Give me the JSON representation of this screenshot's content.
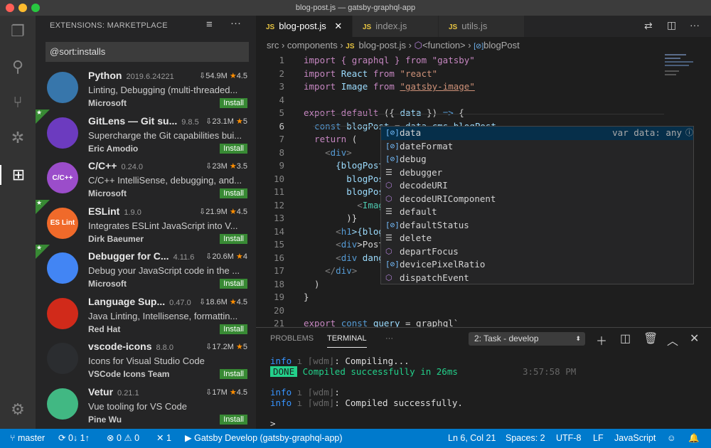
{
  "window": {
    "title": "blog-post.js — gatsby-graphql-app"
  },
  "activity": [
    "files-icon",
    "search-icon",
    "source-control-icon",
    "debug-icon",
    "extensions-icon",
    "gear-icon"
  ],
  "sidebar": {
    "title": "EXTENSIONS: MARKETPLACE",
    "search_value": "@sort:installs",
    "install_label": "Install",
    "extensions": [
      {
        "name": "Python",
        "version": "2019.6.24221",
        "downloads": "54.9M",
        "rating": "4.5",
        "desc": "Linting, Debugging (multi-threaded...",
        "publisher": "Microsoft",
        "featured": false,
        "logo_text": "",
        "logo_color": "#3776ab"
      },
      {
        "name": "GitLens — Git su...",
        "version": "9.8.5",
        "downloads": "23.1M",
        "rating": "5",
        "desc": "Supercharge the Git capabilities bui...",
        "publisher": "Eric Amodio",
        "featured": true,
        "logo_text": "",
        "logo_color": "#6c3bbf"
      },
      {
        "name": "C/C++",
        "version": "0.24.0",
        "downloads": "23M",
        "rating": "3.5",
        "desc": "C/C++ IntelliSense, debugging, and...",
        "publisher": "Microsoft",
        "featured": false,
        "logo_text": "C/C++",
        "logo_color": "#9b4dca"
      },
      {
        "name": "ESLint",
        "version": "1.9.0",
        "downloads": "21.9M",
        "rating": "4.5",
        "desc": "Integrates ESLint JavaScript into V...",
        "publisher": "Dirk Baeumer",
        "featured": true,
        "logo_text": "ES Lint",
        "logo_color": "#f06a2a"
      },
      {
        "name": "Debugger for C...",
        "version": "4.11.6",
        "downloads": "20.6M",
        "rating": "4",
        "desc": "Debug your JavaScript code in the ...",
        "publisher": "Microsoft",
        "featured": true,
        "logo_text": "",
        "logo_color": "#4285f4"
      },
      {
        "name": "Language Sup...",
        "version": "0.47.0",
        "downloads": "18.6M",
        "rating": "4.5",
        "desc": "Java Linting, Intellisense, formattin...",
        "publisher": "Red Hat",
        "featured": false,
        "logo_text": "",
        "logo_color": "#d12a1a"
      },
      {
        "name": "vscode-icons",
        "version": "8.8.0",
        "downloads": "17.2M",
        "rating": "5",
        "desc": "Icons for Visual Studio Code",
        "publisher": "VSCode Icons Team",
        "featured": false,
        "logo_text": "",
        "logo_color": "#2b2d30"
      },
      {
        "name": "Vetur",
        "version": "0.21.1",
        "downloads": "17M",
        "rating": "4.5",
        "desc": "Vue tooling for VS Code",
        "publisher": "Pine Wu",
        "featured": false,
        "logo_text": "",
        "logo_color": "#41b883"
      }
    ]
  },
  "tabs": [
    {
      "label": "blog-post.js",
      "active": true
    },
    {
      "label": "index.js",
      "active": false
    },
    {
      "label": "utils.js",
      "active": false
    }
  ],
  "breadcrumb": [
    "src",
    "components",
    "blog-post.js",
    "<function>",
    "blogPost"
  ],
  "code": [
    [
      [
        "import { graphql } from \"gatsby\"",
        "kw"
      ]
    ],
    [
      [
        "import ",
        "kw"
      ],
      [
        "React ",
        "v"
      ],
      [
        "from ",
        "kw"
      ],
      [
        "\"react\"",
        "s"
      ]
    ],
    [
      [
        "import ",
        "kw"
      ],
      [
        "Image ",
        "v"
      ],
      [
        "from ",
        "kw"
      ],
      [
        "\"gatsby-image\"",
        "u"
      ]
    ],
    [],
    [
      [
        "export default ",
        "kw"
      ],
      [
        "({ ",
        "p"
      ],
      [
        "data",
        "v"
      ],
      [
        " }) ",
        "p"
      ],
      [
        "=>",
        "b"
      ],
      [
        " {",
        "p"
      ]
    ],
    [
      [
        "  const ",
        "b"
      ],
      [
        "blogPost",
        "v"
      ],
      [
        " = ",
        "p"
      ],
      [
        "data",
        "v"
      ],
      [
        ".cms.blogPost",
        "v"
      ]
    ],
    [
      [
        "  return ",
        "kw"
      ],
      [
        "(",
        "p"
      ]
    ],
    [
      [
        "    <",
        "g"
      ],
      [
        "div",
        "b"
      ],
      [
        ">",
        "g"
      ]
    ],
    [
      [
        "      {blogPost",
        "v"
      ]
    ],
    [
      [
        "        blogPos",
        "v"
      ]
    ],
    [
      [
        "        blogPos",
        "v"
      ]
    ],
    [
      [
        "          <",
        "g"
      ],
      [
        "Imag",
        "t"
      ]
    ],
    [
      [
        "        )}",
        "p"
      ]
    ],
    [
      [
        "      <",
        "g"
      ],
      [
        "h1",
        "b"
      ],
      [
        ">{blog",
        "v"
      ]
    ],
    [
      [
        "      <",
        "g"
      ],
      [
        "div",
        "b"
      ],
      [
        ">Post",
        "p"
      ]
    ],
    [
      [
        "      <",
        "g"
      ],
      [
        "div ",
        "b"
      ],
      [
        "dang",
        "v"
      ]
    ],
    [
      [
        "    </",
        "g"
      ],
      [
        "div",
        "b"
      ],
      [
        ">",
        "g"
      ]
    ],
    [
      [
        "  )",
        "p"
      ]
    ],
    [
      [
        "}",
        "p"
      ]
    ],
    [],
    [
      [
        "export ",
        "kw"
      ],
      [
        "const ",
        "b"
      ],
      [
        "query",
        "v"
      ],
      [
        " = graphql`",
        "p"
      ]
    ]
  ],
  "suggest": {
    "detail": "var data: any",
    "items": [
      {
        "label": "data",
        "kind": "variable"
      },
      {
        "label": "dateFormat",
        "kind": "variable"
      },
      {
        "label": "debug",
        "kind": "variable"
      },
      {
        "label": "debugger",
        "kind": "keyword"
      },
      {
        "label": "decodeURI",
        "kind": "method"
      },
      {
        "label": "decodeURIComponent",
        "kind": "method"
      },
      {
        "label": "default",
        "kind": "keyword"
      },
      {
        "label": "defaultStatus",
        "kind": "variable"
      },
      {
        "label": "delete",
        "kind": "keyword"
      },
      {
        "label": "departFocus",
        "kind": "method"
      },
      {
        "label": "devicePixelRatio",
        "kind": "variable"
      },
      {
        "label": "dispatchEvent",
        "kind": "method"
      }
    ]
  },
  "panel": {
    "tabs": [
      "PROBLEMS",
      "TERMINAL"
    ],
    "more": "···",
    "terminal_select": "2: Task - develop",
    "lines": {
      "l1_info": "info",
      "l1_tag": " ı ⌈wdm⌋",
      "l1_msg": ": Compiling...",
      "done": "DONE",
      "done_msg": "Compiled successfully in 26ms",
      "time": "3:57:58 PM",
      "l2_info": "info",
      "l2_tag": " ı ⌈wdm⌋",
      "l2_msg": ":",
      "l3_info": "info",
      "l3_tag": " ı ⌈wdm⌋",
      "l3_msg": ": Compiled successfully.",
      "prompt": ">"
    }
  },
  "status": {
    "branch": "master",
    "sync": "0↓ 1↑",
    "errors": "0",
    "warnings": "0",
    "tools": "1",
    "task": "Gatsby Develop (gatsby-graphql-app)",
    "position": "Ln 6, Col 21",
    "spaces": "Spaces: 2",
    "encoding": "UTF-8",
    "eol": "LF",
    "language": "JavaScript"
  },
  "colors": {
    "accent": "#007acc",
    "install": "#388a34",
    "star": "#ff8e00"
  }
}
